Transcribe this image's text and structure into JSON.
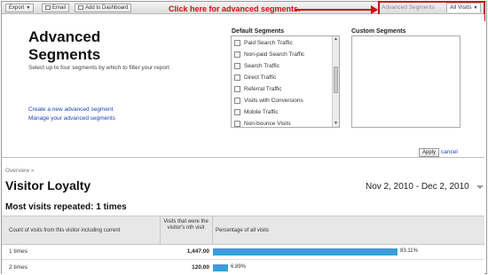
{
  "toolbar": {
    "export_label": "Export",
    "email_label": "Email",
    "dashboard_label": "Add to Dashboard"
  },
  "annotation": {
    "text": "Click here for advanced segments."
  },
  "segments_tabs": {
    "advanced_label": "Advanced Segments",
    "all_visits_label": "All Visits"
  },
  "advanced_panel": {
    "title": "Advanced Segments",
    "subtitle": "Select up to four segments by which to filter your report",
    "create_link": "Create a new advanced segment",
    "manage_link": "Manage your advanced segments",
    "default_heading": "Default Segments",
    "default_items": [
      "Paid Search Traffic",
      "Non-paid Search Traffic",
      "Search Traffic",
      "Direct Traffic",
      "Referral Traffic",
      "Visits with Conversions",
      "Mobile Traffic",
      "Non-bounce Visits"
    ],
    "custom_heading": "Custom Segments",
    "apply_label": "Apply",
    "cancel_label": "cancel"
  },
  "report": {
    "breadcrumb": "Overview »",
    "title": "Visitor Loyalty",
    "date_range": "Nov 2, 2010 - Dec 2, 2010",
    "section_title": "Most visits repeated: 1 times",
    "columns": {
      "count": "Count of visits from this visitor including current",
      "visits": "Visits that were the visitor's nth visit",
      "percentage": "Percentage of all visits"
    },
    "rows": [
      {
        "label": "1 times",
        "visits": "1,447.00",
        "percent_text": "83.11%",
        "percent": 83.11
      },
      {
        "label": "2 times",
        "visits": "120.00",
        "percent_text": "6.89%",
        "percent": 6.89
      }
    ]
  },
  "colors": {
    "annotation_red": "#cc1111",
    "bar_blue": "#3b9ed9",
    "link_blue": "#1a44b8"
  }
}
